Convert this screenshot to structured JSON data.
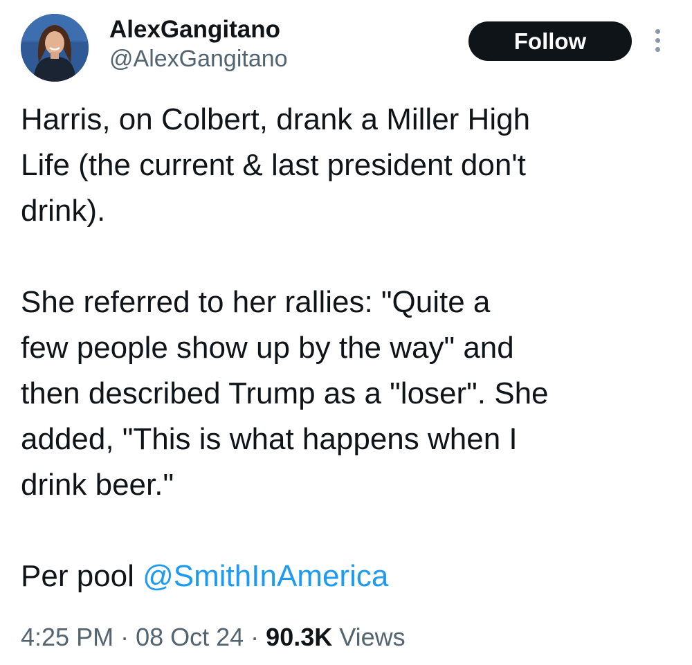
{
  "author": {
    "display_name": "AlexGangitano",
    "handle": "@AlexGangitano"
  },
  "follow_button": {
    "label": "Follow"
  },
  "more_menu": {
    "icon": "more-vertical-icon"
  },
  "tweet": {
    "paragraph_1": "Harris, on Colbert, drank a Miller High\nLife (the current & last president don't\ndrink).",
    "paragraph_2": "She referred to her rallies: \"Quite a\nfew people show up by the way\" and\nthen described Trump as a \"loser\". She\nadded, \"This is what happens when I\ndrink beer.\"",
    "paragraph_3_prefix": "Per pool ",
    "mention": "@SmithInAmerica"
  },
  "meta": {
    "time": "4:25 PM",
    "separator_1": " · ",
    "date": "08 Oct 24",
    "separator_2": " · ",
    "views_count": "90.3K",
    "views_label": " Views"
  },
  "colors": {
    "text": "#0f1419",
    "secondary": "#536471",
    "link": "#1d9bf0",
    "button_bg": "#0f1419"
  }
}
